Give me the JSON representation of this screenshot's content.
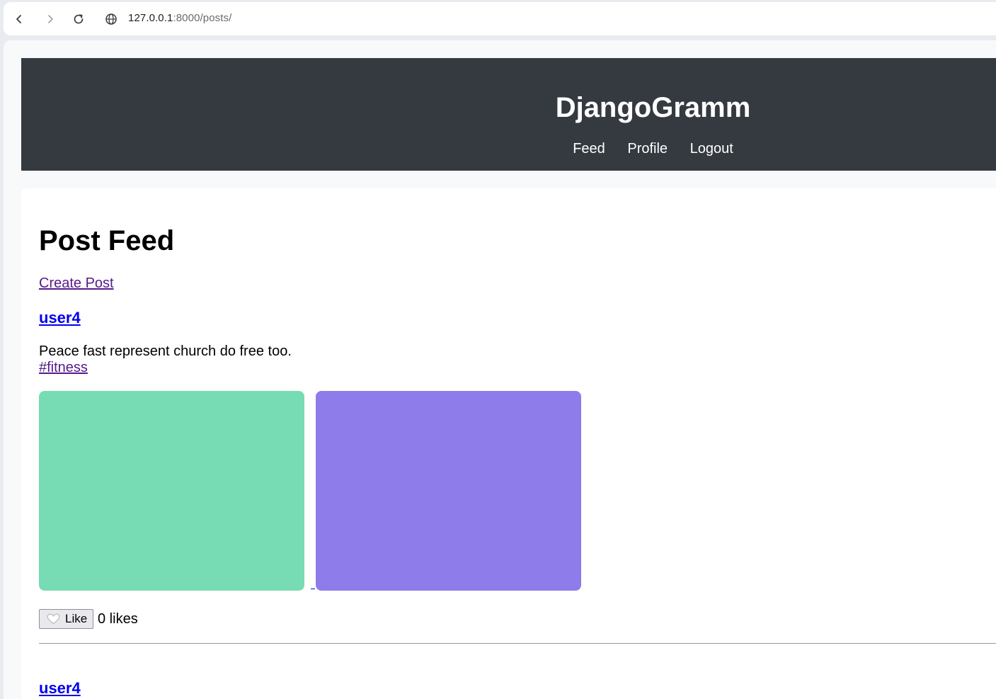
{
  "browser": {
    "url_host": "127.0.0.1",
    "url_path": ":8000/posts/"
  },
  "header": {
    "site_title": "DjangoGramm",
    "nav": [
      {
        "label": "Feed"
      },
      {
        "label": "Profile"
      },
      {
        "label": "Logout"
      }
    ]
  },
  "main": {
    "heading": "Post Feed",
    "create_post_label": "Create Post",
    "posts": [
      {
        "author": "user4",
        "caption": "Peace fast represent church do free too.",
        "tag": "#fitness",
        "images": [
          {
            "color": "#77dbb3"
          },
          {
            "color": "#8e7ceb"
          }
        ],
        "like_label": "Like",
        "likes_text": "0 likes"
      },
      {
        "author": "user4"
      }
    ]
  },
  "icons": {
    "back": "chevron-left-icon",
    "forward": "chevron-right-icon",
    "reload": "reload-icon",
    "site_info": "globe-icon",
    "like": "heart-outline-icon"
  }
}
